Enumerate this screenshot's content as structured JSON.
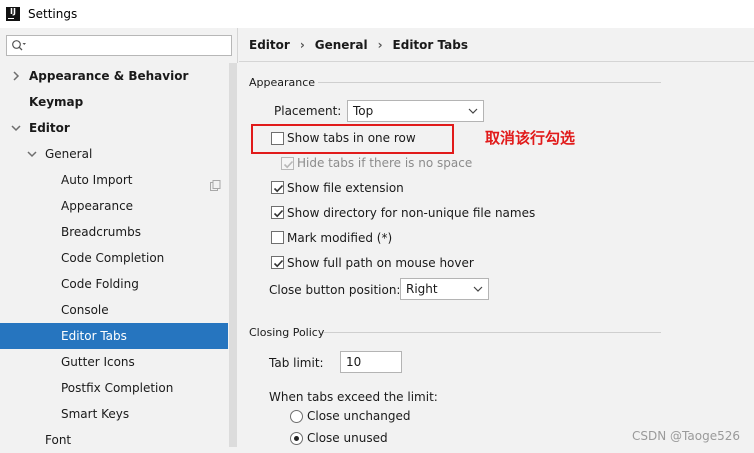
{
  "window": {
    "title": "Settings",
    "app_icon": "IJ"
  },
  "search": {
    "value": "",
    "placeholder": ""
  },
  "sidebar": {
    "items": [
      {
        "label": "Appearance & Behavior",
        "chevron": "›",
        "bold": true
      },
      {
        "label": "Keymap",
        "bold": true
      },
      {
        "label": "Editor",
        "chevron": "⌄",
        "bold": true
      },
      {
        "label": "General",
        "chevron": "⌄"
      },
      {
        "label": "Auto Import"
      },
      {
        "label": "Appearance"
      },
      {
        "label": "Breadcrumbs"
      },
      {
        "label": "Code Completion"
      },
      {
        "label": "Code Folding"
      },
      {
        "label": "Console"
      },
      {
        "label": "Editor Tabs",
        "selected": true
      },
      {
        "label": "Gutter Icons"
      },
      {
        "label": "Postfix Completion"
      },
      {
        "label": "Smart Keys"
      },
      {
        "label": "Font"
      }
    ]
  },
  "breadcrumb": {
    "part1": "Editor",
    "sep1": "›",
    "part2": "General",
    "sep2": "›",
    "part3": "Editor Tabs"
  },
  "appearance": {
    "title": "Appearance",
    "placement_label": "Placement:",
    "placement_value": "Top",
    "show_tabs_one_row": "Show tabs in one row",
    "hide_tabs_no_space": "Hide tabs if there is no space",
    "show_file_extension": "Show file extension",
    "show_directory": "Show directory for non-unique file names",
    "mark_modified": "Mark modified (*)",
    "show_full_path": "Show full path on mouse hover",
    "close_button_label": "Close button position:",
    "close_button_value": "Right"
  },
  "closing": {
    "title": "Closing Policy",
    "tab_limit_label": "Tab limit:",
    "tab_limit_value": "10",
    "exceed_label": "When tabs exceed the limit:",
    "close_unchanged": "Close unchanged",
    "close_unused": "Close unused"
  },
  "annotation": {
    "text": "取消该行勾选",
    "color": "#e11b1b"
  },
  "watermark": "CSDN @Taoge526",
  "colors": {
    "selection": "#2675bf",
    "accent_red": "#e11b1b"
  }
}
